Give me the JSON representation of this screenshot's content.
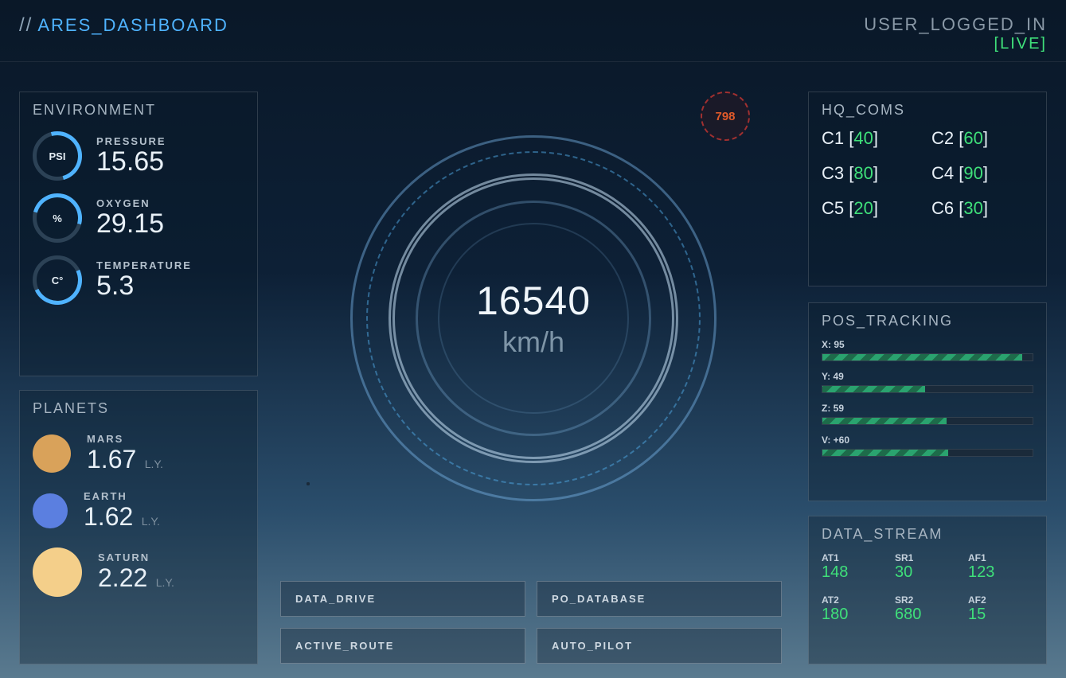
{
  "header": {
    "slashes": "//",
    "title": "ARES_DASHBOARD",
    "user": "USER_LOGGED_IN",
    "live": "[LIVE]"
  },
  "environment": {
    "title": "ENVIRONMENT",
    "items": [
      {
        "unit": "PSI",
        "label": "PRESSURE",
        "value": "15.65"
      },
      {
        "unit": "%",
        "label": "OXYGEN",
        "value": "29.15"
      },
      {
        "unit": "C°",
        "label": "TEMPERATURE",
        "value": "5.3"
      }
    ]
  },
  "planets": {
    "title": "PLANETS",
    "ly_suffix": "L.Y.",
    "items": [
      {
        "name": "MARS",
        "value": "1.67",
        "color": "#d9a25a",
        "size": 48
      },
      {
        "name": "EARTH",
        "value": "1.62",
        "color": "#5b7fe0",
        "size": 44
      },
      {
        "name": "SATURN",
        "value": "2.22",
        "color": "#f4cf8a",
        "size": 62
      }
    ]
  },
  "speed": {
    "value": "16540",
    "unit": "km/h",
    "badge": "798"
  },
  "buttons": [
    "DATA_DRIVE",
    "PO_DATABASE",
    "ACTIVE_ROUTE",
    "AUTO_PILOT"
  ],
  "coms": {
    "title": "HQ_COMS",
    "items": [
      {
        "label": "C1",
        "value": "40"
      },
      {
        "label": "C2",
        "value": "60"
      },
      {
        "label": "C3",
        "value": "80"
      },
      {
        "label": "C4",
        "value": "90"
      },
      {
        "label": "C5",
        "value": "20"
      },
      {
        "label": "C6",
        "value": "30"
      }
    ]
  },
  "pos": {
    "title": "POS_TRACKING",
    "items": [
      {
        "label": "X: 95",
        "pct": 95
      },
      {
        "label": "Y: 49",
        "pct": 49
      },
      {
        "label": "Z: 59",
        "pct": 59
      },
      {
        "label": "V: +60",
        "pct": 60
      }
    ]
  },
  "stream": {
    "title": "DATA_STREAM",
    "items": [
      {
        "label": "AT1",
        "value": "148"
      },
      {
        "label": "SR1",
        "value": "30"
      },
      {
        "label": "AF1",
        "value": "123"
      },
      {
        "label": "AT2",
        "value": "180"
      },
      {
        "label": "SR2",
        "value": "680"
      },
      {
        "label": "AF2",
        "value": "15"
      }
    ]
  }
}
